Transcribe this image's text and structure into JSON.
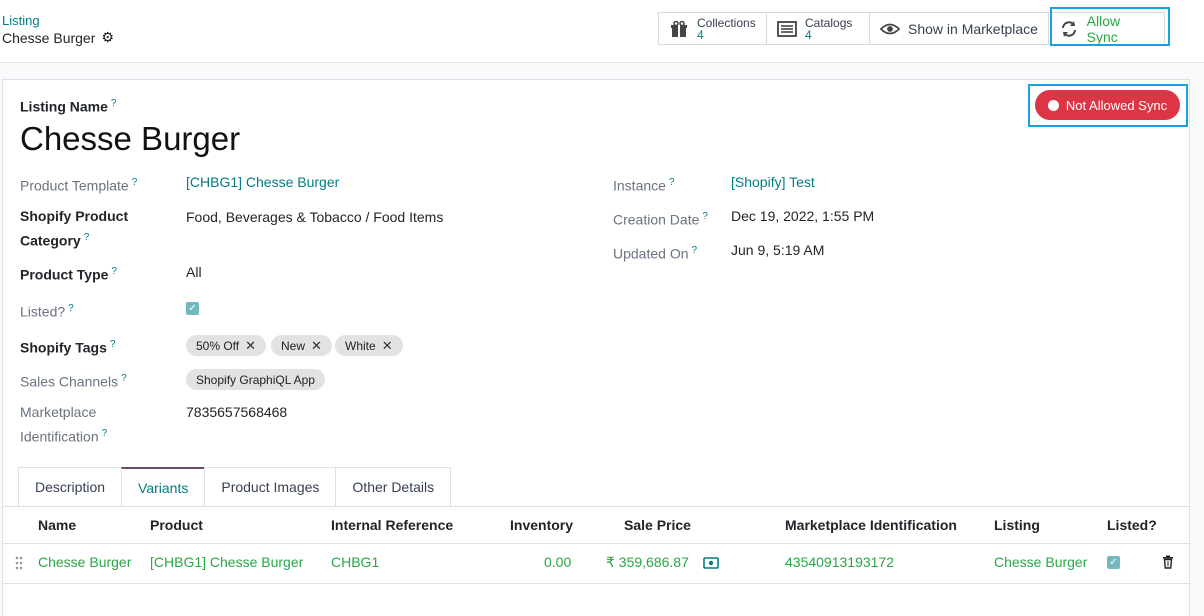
{
  "breadcrumb": {
    "parent": "Listing",
    "current": "Chesse Burger"
  },
  "stats": {
    "collections": {
      "label": "Collections",
      "count": "4"
    },
    "catalogs": {
      "label": "Catalogs",
      "count": "4"
    },
    "marketplace": {
      "label": "Show in Marketplace"
    },
    "sync": {
      "label": "Allow Sync"
    }
  },
  "status_button": {
    "label": "Not Allowed Sync",
    "color": "#dc3545"
  },
  "form": {
    "name_label": "Listing Name",
    "name": "Chesse Burger",
    "left": {
      "product_template": {
        "label": "Product Template",
        "value": "[CHBG1] Chesse Burger"
      },
      "category": {
        "label_1": "Shopify Product",
        "label_2": "Category",
        "value": "Food, Beverages & Tobacco / Food Items"
      },
      "product_type": {
        "label": "Product Type",
        "value": "All"
      },
      "listed": {
        "label": "Listed?",
        "checked": true
      },
      "tags": {
        "label": "Shopify Tags",
        "items": [
          "50% Off",
          "New",
          "White"
        ]
      },
      "channels": {
        "label": "Sales Channels",
        "items": [
          "Shopify GraphiQL App"
        ]
      },
      "marketplace_id": {
        "label_1": "Marketplace",
        "label_2": "Identification",
        "value": "7835657568468"
      }
    },
    "right": {
      "instance": {
        "label": "Instance",
        "value": "[Shopify] Test"
      },
      "creation_date": {
        "label": "Creation Date",
        "value": "Dec 19, 2022, 1:55 PM"
      },
      "updated_on": {
        "label": "Updated On",
        "value": "Jun 9, 5:19 AM"
      }
    }
  },
  "tabs": [
    "Description",
    "Variants",
    "Product Images",
    "Other Details"
  ],
  "active_tab": "Variants",
  "variants_table": {
    "columns": [
      "Name",
      "Product",
      "Internal Reference",
      "Inventory",
      "Sale Price",
      "Marketplace Identification",
      "Listing",
      "Listed?"
    ],
    "rows": [
      {
        "name": "Chesse Burger",
        "product": "[CHBG1] Chesse Burger",
        "internal_ref": "CHBG1",
        "inventory": "0.00",
        "sale_price": "₹ 359,686.87",
        "marketplace_id": "43540913193172",
        "listing": "Chesse Burger",
        "listed": true
      }
    ]
  },
  "colors": {
    "accent": "#017e84",
    "green": "#28a745",
    "highlight": "#1aa1e0"
  }
}
